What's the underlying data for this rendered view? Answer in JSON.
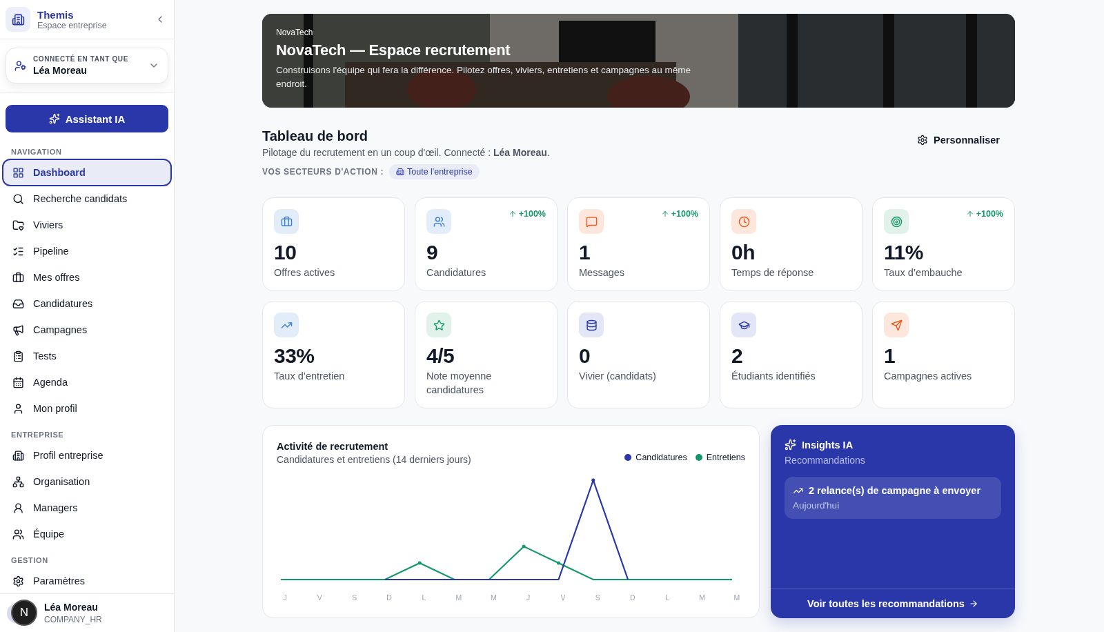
{
  "sidebar": {
    "brand": {
      "name": "Themis",
      "subtitle": "Espace entreprise"
    },
    "account": {
      "caption": "CONNECTÉ EN TANT QUE",
      "name": "Léa Moreau"
    },
    "assistant_button": "Assistant IA",
    "sections": [
      {
        "title": "NAVIGATION",
        "items": [
          {
            "label": "Dashboard",
            "selected": true
          },
          {
            "label": "Recherche candidats",
            "selected": false
          },
          {
            "label": "Viviers",
            "selected": false
          },
          {
            "label": "Pipeline",
            "selected": false
          },
          {
            "label": "Mes offres",
            "selected": false
          },
          {
            "label": "Candidatures",
            "selected": false
          },
          {
            "label": "Campagnes",
            "selected": false
          },
          {
            "label": "Tests",
            "selected": false
          },
          {
            "label": "Agenda",
            "selected": false
          },
          {
            "label": "Mon profil",
            "selected": false
          }
        ]
      },
      {
        "title": "ENTREPRISE",
        "items": [
          {
            "label": "Profil entreprise",
            "selected": false
          },
          {
            "label": "Organisation",
            "selected": false
          },
          {
            "label": "Managers",
            "selected": false
          },
          {
            "label": "Équipe",
            "selected": false
          }
        ]
      },
      {
        "title": "GESTION",
        "items": [
          {
            "label": "Paramètres",
            "selected": false
          }
        ]
      }
    ],
    "footer": {
      "name": "Léa Moreau",
      "role": "COMPANY_HR",
      "dev_badge": "N"
    }
  },
  "banner": {
    "kind": "picture",
    "company": "NovaTech",
    "title": "NovaTech — Espace recrutement",
    "text": "Construisons l'équipe qui fera la différence. Pilotez offres, viviers, entretiens et campagnes au même endroit."
  },
  "header": {
    "title": "Tableau de bord",
    "subtitle": "Pilotage du recrutement en un coup d'œil. Connecté : **Léa Moreau**.",
    "sectors_label": "VOS SECTEURS D'ACTION :",
    "sector_tag": "Toute l'entreprise",
    "customize_button": "Personnaliser"
  },
  "stats": [
    {
      "value": "10",
      "label": "Offres actives"
    },
    {
      "value": "9",
      "label": "Candidatures",
      "trend": "+100%"
    },
    {
      "value": "1",
      "label": "Messages",
      "trend": "+100%"
    },
    {
      "value": "0h",
      "label": "Temps de réponse"
    },
    {
      "value": "11%",
      "label": "Taux d’embauche",
      "trend": "+100%"
    },
    {
      "value": "33%",
      "label": "Taux d’entretien"
    },
    {
      "value": "4/5",
      "label": "Note moyenne candidatures"
    },
    {
      "value": "0",
      "label": "Vivier (candidats)"
    },
    {
      "value": "2",
      "label": "Étudiants identifiés"
    },
    {
      "value": "1",
      "label": "Campagnes actives"
    }
  ],
  "activity": {
    "title": "Activité de recrutement",
    "subtitle": "Candidatures et entretiens (14 derniers jours)",
    "legend": [
      {
        "name": "Candidatures",
        "color": "#2a37a8"
      },
      {
        "name": "Entretiens",
        "color": "#15986a"
      }
    ],
    "x_labels": [
      "J",
      "V",
      "S",
      "D",
      "L",
      "M",
      "M",
      "J",
      "V",
      "S",
      "D",
      "L",
      "M",
      "M"
    ]
  },
  "insights": {
    "title": "Insights IA",
    "subtitle": "Recommandations",
    "items": [
      {
        "title": "2 relance(s) de campagne à envoyer",
        "date": "Aujourd'hui"
      }
    ],
    "link": "Voir toutes les recommandations"
  }
}
